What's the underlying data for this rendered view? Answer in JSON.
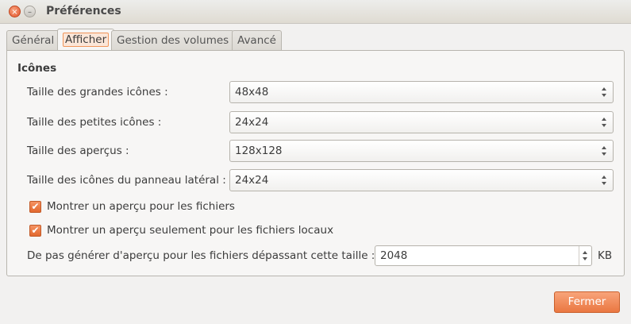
{
  "window": {
    "title": "Préférences",
    "close_glyph": "×",
    "minimize_glyph": "–"
  },
  "tabs": [
    {
      "label": "Général",
      "active": false
    },
    {
      "label": "Afficher",
      "active": true
    },
    {
      "label": "Gestion des volumes",
      "active": false
    },
    {
      "label": "Avancé",
      "active": false
    }
  ],
  "section": {
    "title": "Icônes"
  },
  "settings": [
    {
      "label": "Taille des grandes icônes :",
      "value": "48x48"
    },
    {
      "label": "Taille des petites icônes :",
      "value": "24x24"
    },
    {
      "label": "Taille des aperçus :",
      "value": "128x128"
    },
    {
      "label": "Taille des icônes du panneau latéral :",
      "value": "24x24"
    }
  ],
  "checkboxes": [
    {
      "label": "Montrer un aperçu pour les fichiers",
      "checked": true,
      "glyph": "✔"
    },
    {
      "label": "Montrer un aperçu seulement pour les fichiers locaux",
      "checked": true,
      "glyph": "✔"
    }
  ],
  "preview_limit": {
    "label": "De pas générer d'aperçu pour les fichiers dépassant cette taille :",
    "value": "2048",
    "unit": "KB"
  },
  "footer": {
    "close_label": "Fermer"
  },
  "colors": {
    "accent": "#ea7741",
    "window_bg": "#f2f1f0"
  },
  "icons": {
    "close": "close-icon",
    "minimize": "minimize-icon",
    "combo_arrows": "updown-arrows-icon",
    "check": "check-icon"
  }
}
